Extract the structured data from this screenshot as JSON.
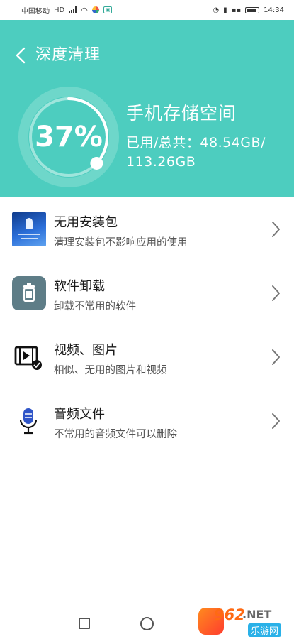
{
  "status_bar": {
    "carrier": "中国移动",
    "network": "HD",
    "time": "14:34"
  },
  "header": {
    "title": "深度清理",
    "percent": "37%",
    "used_fraction": 0.37,
    "storage_title": "手机存储空间",
    "storage_line1": "已用/总共：48.54GB/",
    "storage_line2": "113.26GB"
  },
  "items": [
    {
      "title": "无用安装包",
      "subtitle": "清理安装包不影响应用的使用",
      "icon": "package-icon"
    },
    {
      "title": "软件卸载",
      "subtitle": "卸载不常用的软件",
      "icon": "trash-icon"
    },
    {
      "title": "视频、图片",
      "subtitle": "相似、无用的图片和视频",
      "icon": "video-icon"
    },
    {
      "title": "音频文件",
      "subtitle": "不常用的音频文件可以删除",
      "icon": "microphone-icon"
    }
  ],
  "watermark": {
    "number": "962",
    "domain": ".NET",
    "tag": "乐游网"
  },
  "colors": {
    "header_bg": "#4dcdbf",
    "ring_track": "#8fe0d6",
    "ring_fill": "#ffffff",
    "chevron": "#777777"
  }
}
